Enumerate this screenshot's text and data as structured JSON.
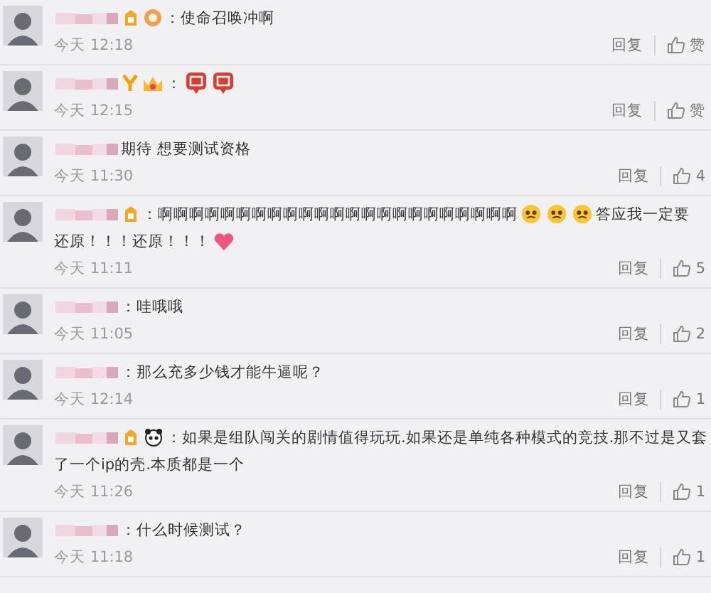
{
  "comments": [
    {
      "badges": [
        {
          "kind": "vip"
        },
        {
          "kind": "medal"
        }
      ],
      "lines": [
        [
          {
            "kind": "text",
            "text": "：使命召唤冲啊"
          }
        ]
      ],
      "time": "今天 12:18",
      "reply": "回复",
      "likes": "赞"
    },
    {
      "badges": [
        {
          "kind": "y"
        },
        {
          "kind": "crown"
        }
      ],
      "lines": [
        [
          {
            "kind": "text",
            "text": "："
          },
          {
            "kind": "sticker"
          },
          {
            "kind": "sticker"
          }
        ]
      ],
      "time": "今天 12:15",
      "reply": "回复",
      "likes": "赞"
    },
    {
      "lines": [
        [
          {
            "kind": "text",
            "text": "期待 想要测试资格"
          }
        ]
      ],
      "time": "今天 11:30",
      "reply": "回复",
      "likes": "4"
    },
    {
      "badges": [
        {
          "kind": "vip"
        }
      ],
      "lines": [
        [
          {
            "kind": "text",
            "text": "：啊啊啊啊啊啊啊啊啊啊啊啊啊啊啊啊啊啊啊啊啊啊啊"
          },
          {
            "kind": "face"
          },
          {
            "kind": "face"
          },
          {
            "kind": "face"
          },
          {
            "kind": "text",
            "text": "答应我一定要"
          }
        ],
        [
          {
            "kind": "text",
            "text": "还原！！！还原！！！"
          },
          {
            "kind": "heart"
          }
        ]
      ],
      "time": "今天 11:11",
      "reply": "回复",
      "likes": "5"
    },
    {
      "lines": [
        [
          {
            "kind": "text",
            "text": "：哇哦哦"
          }
        ]
      ],
      "time": "今天 11:05",
      "reply": "回复",
      "likes": "2"
    },
    {
      "lines": [
        [
          {
            "kind": "text",
            "text": "：那么充多少钱才能牛逼呢？"
          }
        ]
      ],
      "time": "今天 12:14",
      "reply": "回复",
      "likes": "1"
    },
    {
      "badges": [
        {
          "kind": "vip"
        },
        {
          "kind": "panda"
        }
      ],
      "lines": [
        [
          {
            "kind": "text",
            "text": "：如果是组队闯关的剧情值得玩玩.如果还是单纯各种模式的竞技.那不过是又套"
          }
        ],
        [
          {
            "kind": "text",
            "text": "了一个ip的壳.本质都是一个"
          }
        ]
      ],
      "time": "今天 11:26",
      "reply": "回复",
      "likes": "1"
    },
    {
      "lines": [
        [
          {
            "kind": "text",
            "text": "：什么时候测试？"
          }
        ]
      ],
      "time": "今天 11:18",
      "reply": "回复",
      "likes": "1"
    }
  ]
}
